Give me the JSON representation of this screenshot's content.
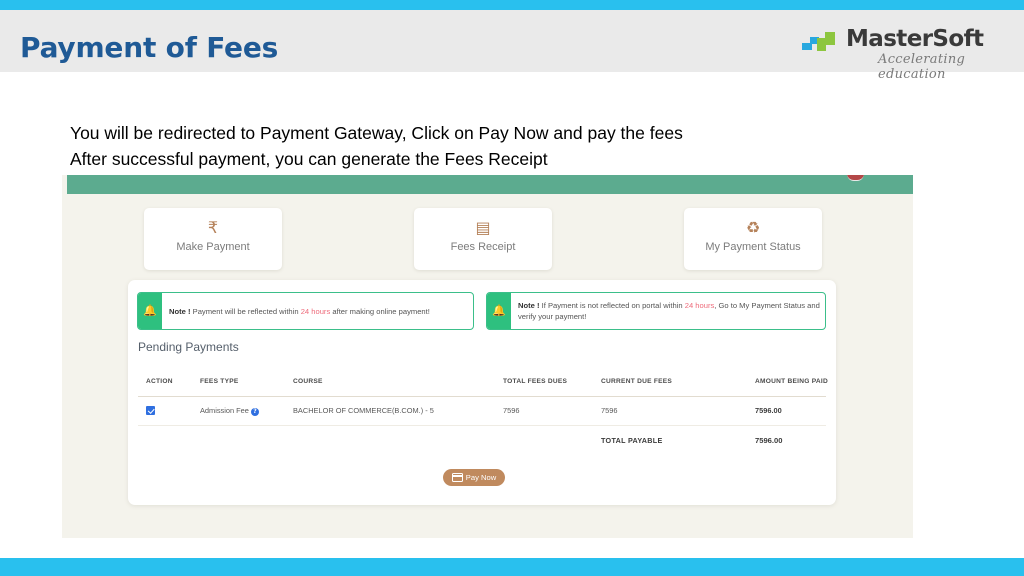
{
  "slide": {
    "title": "Payment of Fees",
    "accent_color": "#29c0ee",
    "title_color": "#1f5a96",
    "header_bg": "#eaeaea"
  },
  "brand": {
    "name": "MasterSoft",
    "tagline": "Accelerating education",
    "logo_icon": "mastersoft-arrows-logo"
  },
  "instructions": {
    "line1": "You will be redirected to Payment Gateway, Click  on Pay Now and pay the fees",
    "line2": "After successful payment, you can generate the Fees Receipt"
  },
  "app": {
    "topbar_color": "#5cab8f",
    "panel_bg": "#f4f3ec",
    "quick_cards": [
      {
        "icon": "rupee-icon",
        "glyph": "₹",
        "label": "Make Payment"
      },
      {
        "icon": "credit-card-icon",
        "glyph": "▤",
        "label": "Fees Receipt"
      },
      {
        "icon": "recycle-icon",
        "glyph": "♻",
        "label": "My Payment Status"
      }
    ],
    "notes": [
      {
        "icon": "bell-icon",
        "label": "Note !",
        "text_before": " Payment will be reflected within ",
        "highlight": "24  hours",
        "text_after": " after making online payment!"
      },
      {
        "icon": "bell-icon",
        "label": "Note !",
        "text_before": " If Payment is not reflected on portal within ",
        "highlight": "24  hours",
        "text_after": ", Go to My Payment Status and verify your payment!"
      }
    ],
    "section_title": "Pending Payments",
    "table": {
      "headers": {
        "action": "ACTION",
        "fees_type": "FEES TYPE",
        "course": "COURSE",
        "total_fees_dues": "TOTAL FEES DUES",
        "current_due_fees": "CURRENT DUE FEES",
        "amount_being_paid": "AMOUNT BEING PAID"
      },
      "rows": [
        {
          "checked": true,
          "fees_type": "Admission Fee",
          "info_icon": "question-mark-icon",
          "course": "BACHELOR OF COMMERCE(B.COM.) - 5",
          "total_fees_dues": "7596",
          "current_due_fees": "7596",
          "amount_being_paid": "7596.00"
        }
      ],
      "total_label": "TOTAL PAYABLE",
      "total_value": "7596.00"
    },
    "pay_button": {
      "label": "Pay Now",
      "icon": "credit-card-icon",
      "color": "#c08a5e"
    }
  }
}
